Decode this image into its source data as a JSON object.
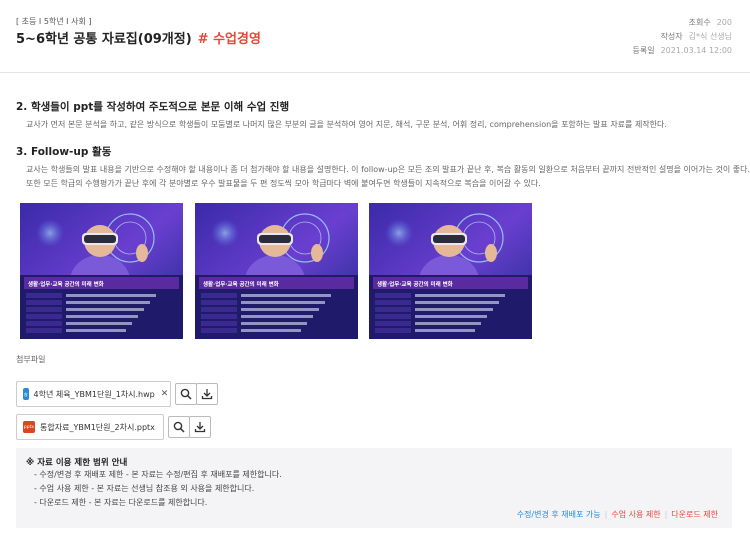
{
  "header": {
    "breadcrumb": "[ 초등 I 5학년 I 사회 ]",
    "title": "5~6학년 공통 자료집(09개정)",
    "tag": "# 수업경영",
    "meta": [
      {
        "key": "조회수",
        "value": "200"
      },
      {
        "key": "작성자",
        "value": "김*식 선생님"
      },
      {
        "key": "등록일",
        "value": "2021.03.14 12:00"
      }
    ]
  },
  "sections": [
    {
      "title": "2. 학생들이 ppt를 작성하여 주도적으로 본문 이해 수업 진행",
      "lines": [
        "교사가 먼저 본문 분석을 하고, 같은 방식으로 학생들이 모둠별로 나머지 많은 부분의 글을 분석하여 영어 지문, 해석, 구문 분석, 어휘 정리, comprehension을 포함하는 발표 자료를 제작한다."
      ]
    },
    {
      "title": "3. Follow-up 활동",
      "lines": [
        "교사는 학생들의 발표 내용을 기반으로 수정해야 할 내용이나 좀 더 첨가해야 할 내용을 설명한다. 이 follow-up은 모든 조의 발표가 끝난 후, 복습 활동의 일환으로 처음부터 끝까지 전반적인 설명을 이어가는 것이 좋다.",
        "또한 모든 학급의 수행평가가 끝난 후에 각 분야별로 우수 발표물을 두 편 정도씩 모아 학급마다 벽에 붙여두면 학생들이 지속적으로 복습을 이어갈 수 있다."
      ]
    }
  ],
  "thumbnails": {
    "caption": "생활·업무·교육 공간의 미래 변화",
    "count_label": "3"
  },
  "attachments": {
    "label": "첨부파일",
    "files": [
      {
        "name": "4학년 체육_YBM1단원_1차시.hwp",
        "icon_color": "#2a8ad8",
        "icon_text": "ㅎ"
      },
      {
        "name": "통합자료_YBM1단원_2차시.pptx",
        "icon_color": "#d9461f",
        "icon_text": "pptx"
      }
    ],
    "close_glyph": "✕"
  },
  "notice": {
    "title": "※ 자료 이용 제한 범위 안내",
    "lines": [
      "- 수정/변경 후 재배포 제한 - 본 자료는 수정/편집 후 재배포를 제한합니다.",
      "- 수업 사용 제한 - 본 자료는 선생님 참조용 외 사용을 제한합니다.",
      "- 다운로드 제한 - 본 자료는 다운로드를 제한합니다."
    ],
    "links": [
      {
        "label": "수정/변경 후 재배포 가능",
        "color": "#2a8ad8"
      },
      {
        "label": "수업 사용 제한",
        "color": "#e8463a"
      },
      {
        "label": "다운로드 제한",
        "color": "#e8463a"
      }
    ]
  },
  "colors": {
    "accent": "#e8463a",
    "link_blue": "#2a8ad8"
  }
}
